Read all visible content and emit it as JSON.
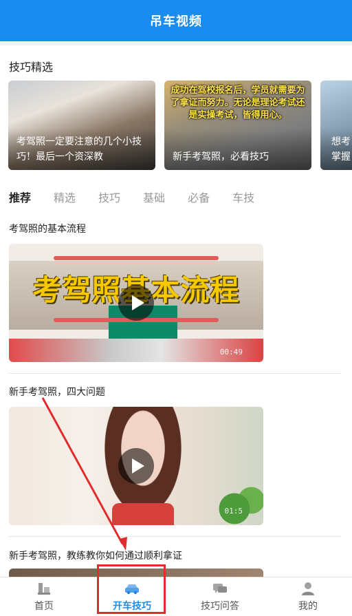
{
  "header": {
    "title": "吊车视频"
  },
  "featured": {
    "title": "技巧精选",
    "cards": [
      {
        "caption": "考驾照一定要注意的几个小技巧！最后一个资深教"
      },
      {
        "overlay": "成功在驾校报名后，学员就需要为了拿证而努力。无论是理论考试还是实操考试，皆得用心。",
        "caption": "新手考驾照，必看技巧"
      },
      {
        "caption": "想考掌握"
      }
    ]
  },
  "tabs": [
    "推荐",
    "精选",
    "技巧",
    "基础",
    "必备",
    "车技"
  ],
  "videos": [
    {
      "title": "考驾照的基本流程",
      "overlay": "考驾照基本流程",
      "duration": "00:49"
    },
    {
      "title": "新手考驾照，四大问题",
      "duration": "01:5"
    },
    {
      "title": "新手考驾照，教练教你如何通过顺利拿证"
    }
  ],
  "tabbar": {
    "items": [
      {
        "label": "首页",
        "icon": "home-icon"
      },
      {
        "label": "开车技巧",
        "icon": "car-icon"
      },
      {
        "label": "技巧问答",
        "icon": "chat-icon"
      },
      {
        "label": "我的",
        "icon": "user-icon"
      }
    ]
  },
  "colors": {
    "primary": "#1a8cf0",
    "annotation": "#e02c2c"
  }
}
